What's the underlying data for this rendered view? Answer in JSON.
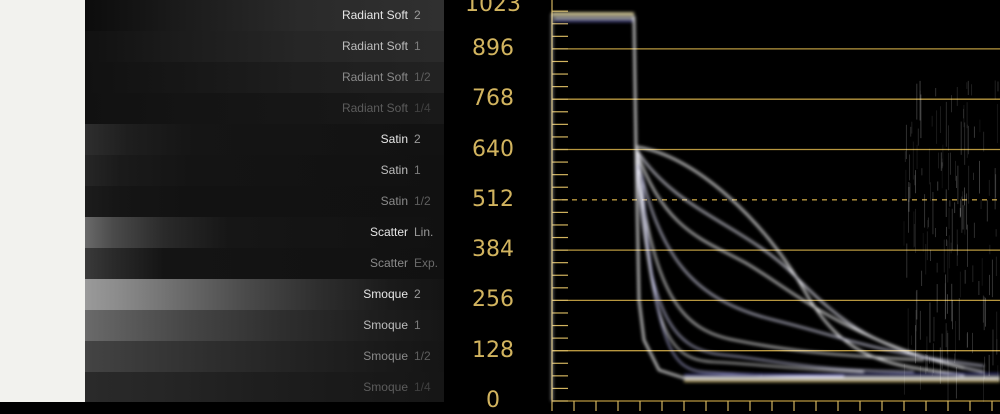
{
  "swatches": [
    {
      "name": "Radiant Soft",
      "level": "2",
      "label_color": "#e6e6e6",
      "level_color": "#9a9a9a"
    },
    {
      "name": "Radiant Soft",
      "level": "1",
      "label_color": "#bdbdbd",
      "level_color": "#7c7c7c"
    },
    {
      "name": "Radiant Soft",
      "level": "1/2",
      "label_color": "#8a8a8a",
      "level_color": "#5e5e5e"
    },
    {
      "name": "Radiant Soft",
      "level": "1/4",
      "label_color": "#5c5c5c",
      "level_color": "#404040"
    },
    {
      "name": "Satin",
      "level": "2",
      "label_color": "#e6e6e6",
      "level_color": "#9a9a9a"
    },
    {
      "name": "Satin",
      "level": "1",
      "label_color": "#bdbdbd",
      "level_color": "#7c7c7c"
    },
    {
      "name": "Satin",
      "level": "1/2",
      "label_color": "#8a8a8a",
      "level_color": "#5e5e5e"
    },
    {
      "name": "Scatter",
      "level": "Lin.",
      "label_color": "#e6e6e6",
      "level_color": "#9a9a9a"
    },
    {
      "name": "Scatter",
      "level": "Exp.",
      "label_color": "#8a8a8a",
      "level_color": "#6a6a6a"
    },
    {
      "name": "Smoque",
      "level": "2",
      "label_color": "#e6e6e6",
      "level_color": "#9a9a9a"
    },
    {
      "name": "Smoque",
      "level": "1",
      "label_color": "#bdbdbd",
      "level_color": "#7c7c7c"
    },
    {
      "name": "Smoque",
      "level": "1/2",
      "label_color": "#8a8a8a",
      "level_color": "#5e5e5e"
    },
    {
      "name": "Smoque",
      "level": "1/4",
      "label_color": "#5c5c5c",
      "level_color": "#404040"
    }
  ],
  "waveform": {
    "scale_labels": [
      "1023",
      "896",
      "768",
      "640",
      "512",
      "384",
      "256",
      "128",
      "0"
    ],
    "accent_color": "#d2b45f",
    "gridline_color": "#b8973f"
  }
}
